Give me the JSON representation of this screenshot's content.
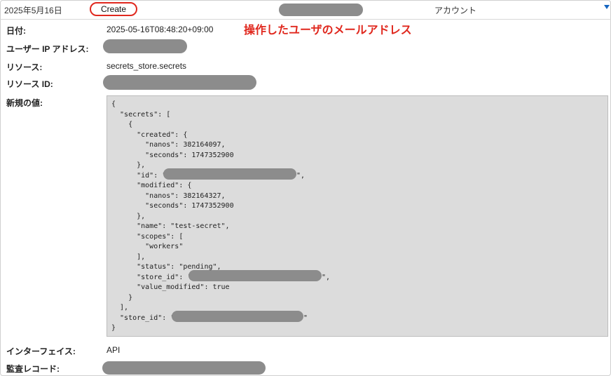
{
  "header": {
    "date": "2025年5月16日",
    "action": "Create",
    "account_label": "アカウント"
  },
  "annotation": "操作したユーザのメールアドレス",
  "fields": {
    "date_label": "日付:",
    "date_value": "2025-05-16T08:48:20+09:00",
    "user_ip_label": "ユーザー IP アドレス:",
    "resource_label": "リソース:",
    "resource_value": "secrets_store.secrets",
    "resource_id_label": "リソース ID:",
    "new_value_label": "新規の値:",
    "interface_label": "インターフェイス:",
    "interface_value": "API",
    "audit_record_label": "監査レコード:"
  },
  "json_lines": [
    "{",
    "  \"secrets\": [",
    "    {",
    "      \"created\": {",
    "        \"nanos\": 382164097,",
    "        \"seconds\": 1747352900",
    "      },",
    "      \"id\": \"",
    "      \"modified\": {",
    "        \"nanos\": 382164327,",
    "        \"seconds\": 1747352900",
    "      },",
    "      \"name\": \"test-secret\",",
    "      \"scopes\": [",
    "        \"workers\"",
    "      ],",
    "      \"status\": \"pending\",",
    "      \"store_id\": \"",
    "      \"value_modified\": true",
    "    }",
    "  ],",
    "  \"store_id\": \"",
    "}"
  ],
  "json_suffix": {
    "id": "\",",
    "store_id_inner": "\",",
    "store_id_outer": "\""
  },
  "colors": {
    "annotation": "#e0281e",
    "highlight_border": "#e0281e",
    "redaction": "#8c8c8c",
    "json_background": "#dcdcdc",
    "caret": "#1565c0"
  }
}
